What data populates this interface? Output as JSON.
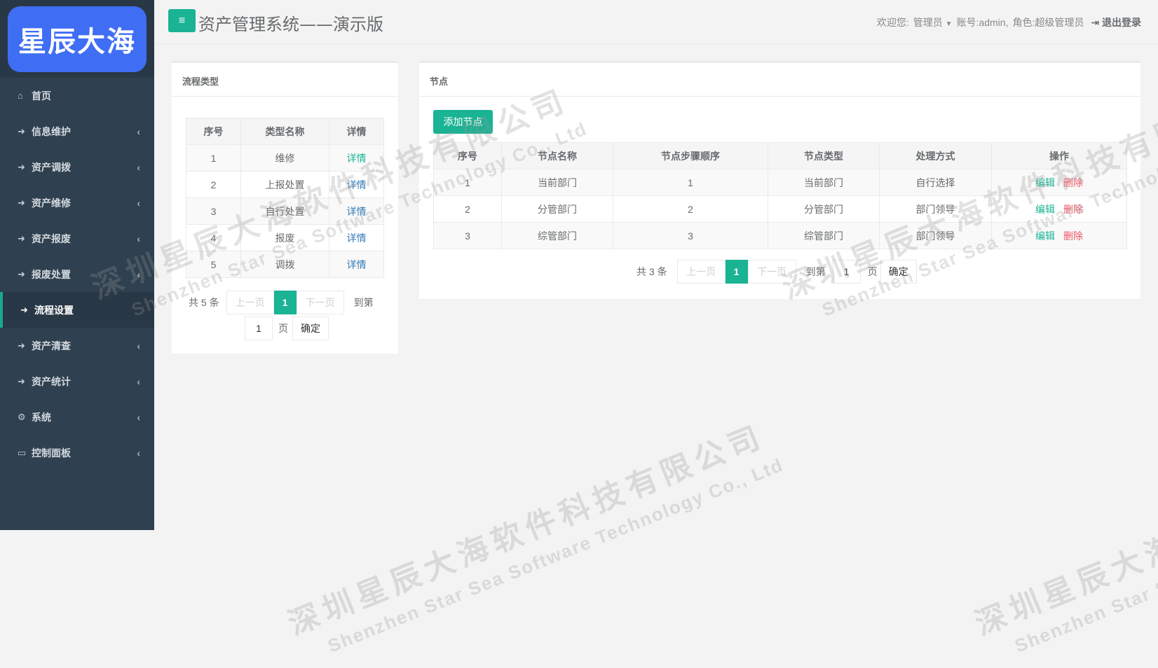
{
  "logo": {
    "text": "星辰大海"
  },
  "header": {
    "title": "资产管理系统——演示版",
    "welcome": "欢迎您:",
    "user": "管理员",
    "account": "账号:admin,",
    "role": "角色:超级管理员",
    "logout": "退出登录"
  },
  "sidebar": {
    "items": [
      {
        "label": "首页",
        "icon": "home-icon"
      },
      {
        "label": "信息维护",
        "icon": "arrow-right-icon"
      },
      {
        "label": "资产调拨",
        "icon": "arrow-right-icon"
      },
      {
        "label": "资产维修",
        "icon": "arrow-right-icon"
      },
      {
        "label": "资产报废",
        "icon": "arrow-right-icon"
      },
      {
        "label": "报废处置",
        "icon": "arrow-right-icon"
      },
      {
        "label": "流程设置",
        "icon": "arrow-right-icon",
        "active": true
      },
      {
        "label": "资产清查",
        "icon": "arrow-right-icon"
      },
      {
        "label": "资产统计",
        "icon": "arrow-right-icon"
      },
      {
        "label": "系统",
        "icon": "gear-icon"
      },
      {
        "label": "控制面板",
        "icon": "monitor-icon"
      }
    ]
  },
  "flow_panel": {
    "title": "流程类型",
    "columns": [
      "序号",
      "类型名称",
      "详情"
    ],
    "rows": [
      {
        "no": "1",
        "name": "维修",
        "detail": "详情"
      },
      {
        "no": "2",
        "name": "上报处置",
        "detail": "详情"
      },
      {
        "no": "3",
        "name": "自行处置",
        "detail": "详情"
      },
      {
        "no": "4",
        "name": "报废",
        "detail": "详情"
      },
      {
        "no": "5",
        "name": "调拨",
        "detail": "详情"
      }
    ],
    "pager": {
      "total": "共 5 条",
      "prev": "上一页",
      "current": "1",
      "next": "下一页",
      "goto": "到第",
      "page_value": "1",
      "page_unit": "页",
      "confirm": "确定"
    }
  },
  "node_panel": {
    "title": "节点",
    "add_button": "添加节点",
    "columns": [
      "序号",
      "节点名称",
      "节点步骤顺序",
      "节点类型",
      "处理方式",
      "操作"
    ],
    "rows": [
      {
        "no": "1",
        "name": "当前部门",
        "order": "1",
        "type": "当前部门",
        "method": "自行选择",
        "edit": "编辑",
        "delete": "删除"
      },
      {
        "no": "2",
        "name": "分管部门",
        "order": "2",
        "type": "分管部门",
        "method": "部门领导",
        "edit": "编辑",
        "delete": "删除"
      },
      {
        "no": "3",
        "name": "综管部门",
        "order": "3",
        "type": "综管部门",
        "method": "部门领导",
        "edit": "编辑",
        "delete": "删除"
      }
    ],
    "pager": {
      "total": "共 3 条",
      "prev": "上一页",
      "current": "1",
      "next": "下一页",
      "goto": "到第",
      "page_value": "1",
      "page_unit": "页",
      "confirm": "确定"
    }
  },
  "watermark": {
    "cn": "深圳星辰大海软件科技有限公司",
    "en": "Shenzhen Star Sea Software Technology Co., Ltd"
  },
  "colors": {
    "sidebar": "#2f4050",
    "accent": "#1ab394",
    "logo": "#3f6ef4",
    "danger": "#ed5565",
    "link": "#337ab7"
  }
}
